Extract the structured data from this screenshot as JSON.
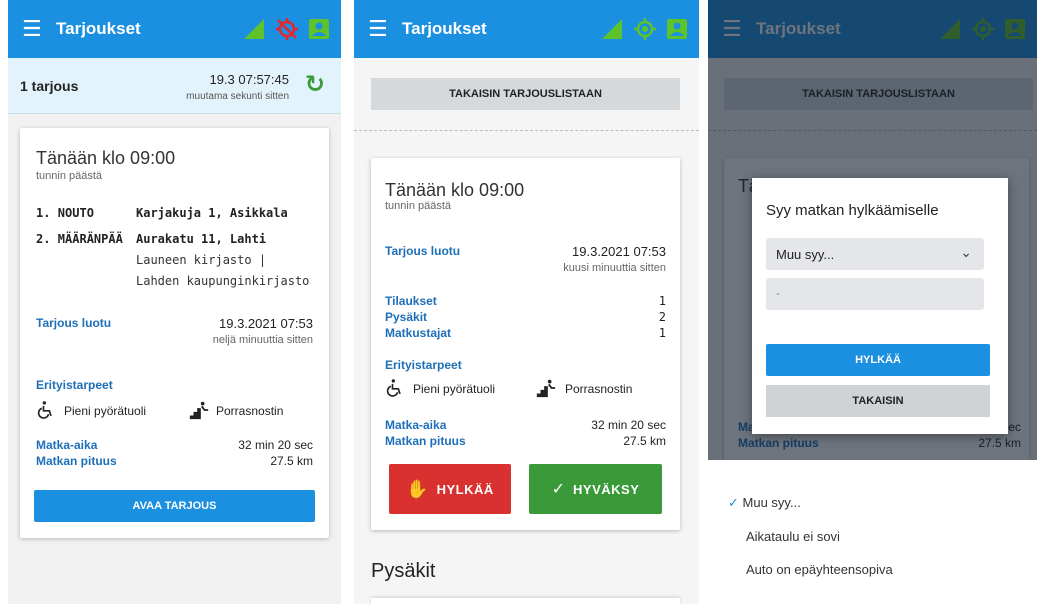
{
  "app": {
    "title": "Tarjoukset"
  },
  "colors": {
    "primary": "#1b8fe0",
    "signal": "#5ec22a",
    "gps_off": "#e8252b",
    "reject": "#d93030",
    "accept": "#3a9a3a",
    "label": "#1e6fb8"
  },
  "icons": [
    "menu-icon",
    "signal-icon",
    "gps-off-icon",
    "gps-icon",
    "profile-icon",
    "refresh-icon",
    "wheelchair-icon",
    "stair-lift-icon",
    "hand-stop-icon",
    "check-icon",
    "chevron-down-icon"
  ],
  "list": {
    "count_label": "1 tarjous",
    "updated_time": "19.3 07:57:45",
    "updated_ago": "muutama sekunti sitten"
  },
  "offer": {
    "time": "Tänään klo 09:00",
    "time_relative": "tunnin päästä",
    "stops": [
      {
        "index": "1.",
        "type": "NOUTO",
        "address": "Karjakuja 1, Asikkala"
      },
      {
        "index": "2.",
        "type": "MÄÄRÄNPÄÄ",
        "address": "Aurakatu 11, Lahti",
        "note": "Launeen kirjasto | Lahden kaupunginkirjasto"
      }
    ],
    "created_label": "Tarjous luotu",
    "created_value": "19.3.2021 07:53",
    "created_ago_list": "neljä minuuttia sitten",
    "created_ago_detail": "kuusi minuuttia sitten",
    "special_needs_label": "Erityistarpeet",
    "needs": [
      "Pieni pyörätuoli",
      "Porrasnostin"
    ],
    "duration_label": "Matka-aika",
    "duration_value": "32 min 20 sec",
    "length_label": "Matkan pituus",
    "length_value": "27.5 km",
    "open_button": "AVAA TARJOUS"
  },
  "detail": {
    "back_button": "TAKAISIN TARJOUSLISTAAN",
    "counts": [
      {
        "label": "Tilaukset",
        "value": "1"
      },
      {
        "label": "Pysäkit",
        "value": "2"
      },
      {
        "label": "Matkustajat",
        "value": "1"
      }
    ],
    "reject_button": "HYLKÄÄ",
    "accept_button": "HYVÄKSY",
    "stops_heading": "Pysäkit"
  },
  "dialog": {
    "title": "Syy matkan hylkäämiselle",
    "select_value": "Muu syy...",
    "text_placeholder": "-",
    "reject_button": "HYLKÄÄ",
    "back_button": "TAKAISIN"
  },
  "reason_options": [
    {
      "label": "Muu syy...",
      "selected": true
    },
    {
      "label": "Aikataulu ei sovi",
      "selected": false
    },
    {
      "label": "Auto on epäyhteensopiva",
      "selected": false
    }
  ]
}
